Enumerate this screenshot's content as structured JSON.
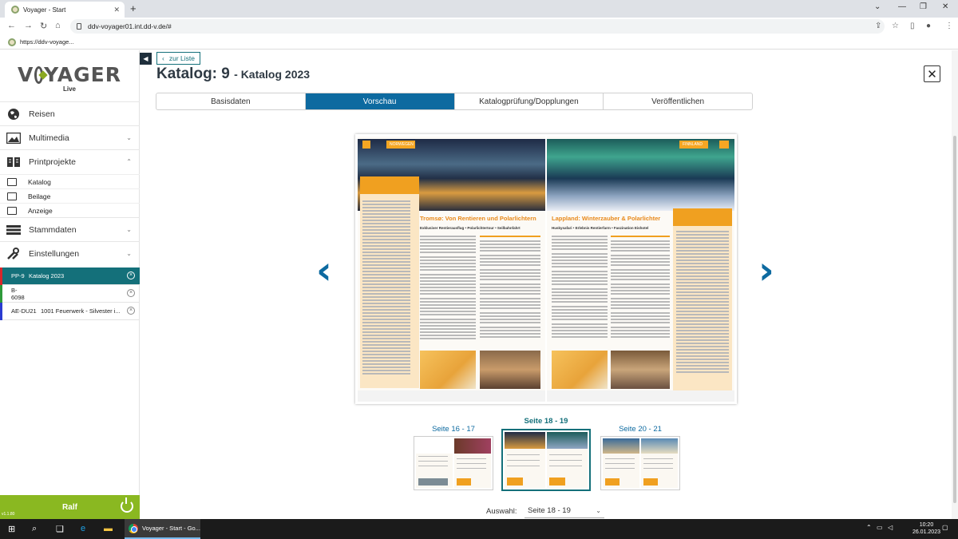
{
  "browser": {
    "tab_title": "Voyager - Start",
    "url": "ddv-voyager01.int.dd-v.de/#",
    "bookmark": "https://ddv-voyage..."
  },
  "sidebar": {
    "logo_text": "VOYAGER",
    "logo_sub": "Live",
    "menu": [
      {
        "label": "Reisen",
        "icon": "globe-icon"
      },
      {
        "label": "Multimedia",
        "icon": "image-icon"
      },
      {
        "label": "Printprojekte",
        "icon": "book-icon"
      }
    ],
    "print_sub": [
      {
        "label": "Katalog",
        "icon": "catalog-icon"
      },
      {
        "label": "Beilage",
        "icon": "insert-icon"
      },
      {
        "label": "Anzeige",
        "icon": "ad-icon"
      }
    ],
    "menu2": [
      {
        "label": "Stammdaten",
        "icon": "database-icon"
      },
      {
        "label": "Einstellungen",
        "icon": "tools-icon"
      }
    ],
    "work_items": [
      {
        "code": "PP-9",
        "label": "Katalog 2023",
        "color": "#d9262c",
        "active": true
      },
      {
        "code": "B-6098",
        "label": "",
        "color": "#2e9a3a",
        "active": false
      },
      {
        "code": "AE-DU21",
        "label": "1001 Feuerwerk - Silvester i...",
        "color": "#2a3bd1",
        "active": false
      }
    ],
    "user": "Ralf",
    "version": "v1.1.80"
  },
  "main": {
    "back_label": "zur Liste",
    "title": "Katalog: 9",
    "subtitle": "- Katalog 2023",
    "tabs": [
      "Basisdaten",
      "Vorschau",
      "Katalogprüfung/Dopplungen",
      "Veröffentlichen"
    ],
    "active_tab": 1,
    "spread": {
      "left_header": "NORWEGEN",
      "right_header": "FINNLAND",
      "left_title": "Tromsø: Von Rentieren und Polarlichtern",
      "left_sub": "Exklusiver Rentierausflug • Polarlichtertour • Seilbahnfahrt",
      "right_title": "Lappland: Winterzauber & Polarlichter",
      "right_sub": "Huskysafari • Erlebnis Rentierfarm • Faszination Eishotel"
    },
    "thumbnails": [
      {
        "label": "Seite 16 - 17",
        "active": false
      },
      {
        "label": "Seite 18 - 19",
        "active": true
      },
      {
        "label": "Seite 20 - 21",
        "active": false
      }
    ],
    "selection_label": "Auswahl:",
    "selection_value": "Seite 18 - 19"
  },
  "taskbar": {
    "app_label": "Voyager - Start - Go...",
    "time": "10:20",
    "date": "26.01.2023"
  },
  "colors": {
    "accent": "#0d6aa0",
    "teal": "#14707a",
    "green": "#8ab821",
    "orange": "#f0a020"
  }
}
